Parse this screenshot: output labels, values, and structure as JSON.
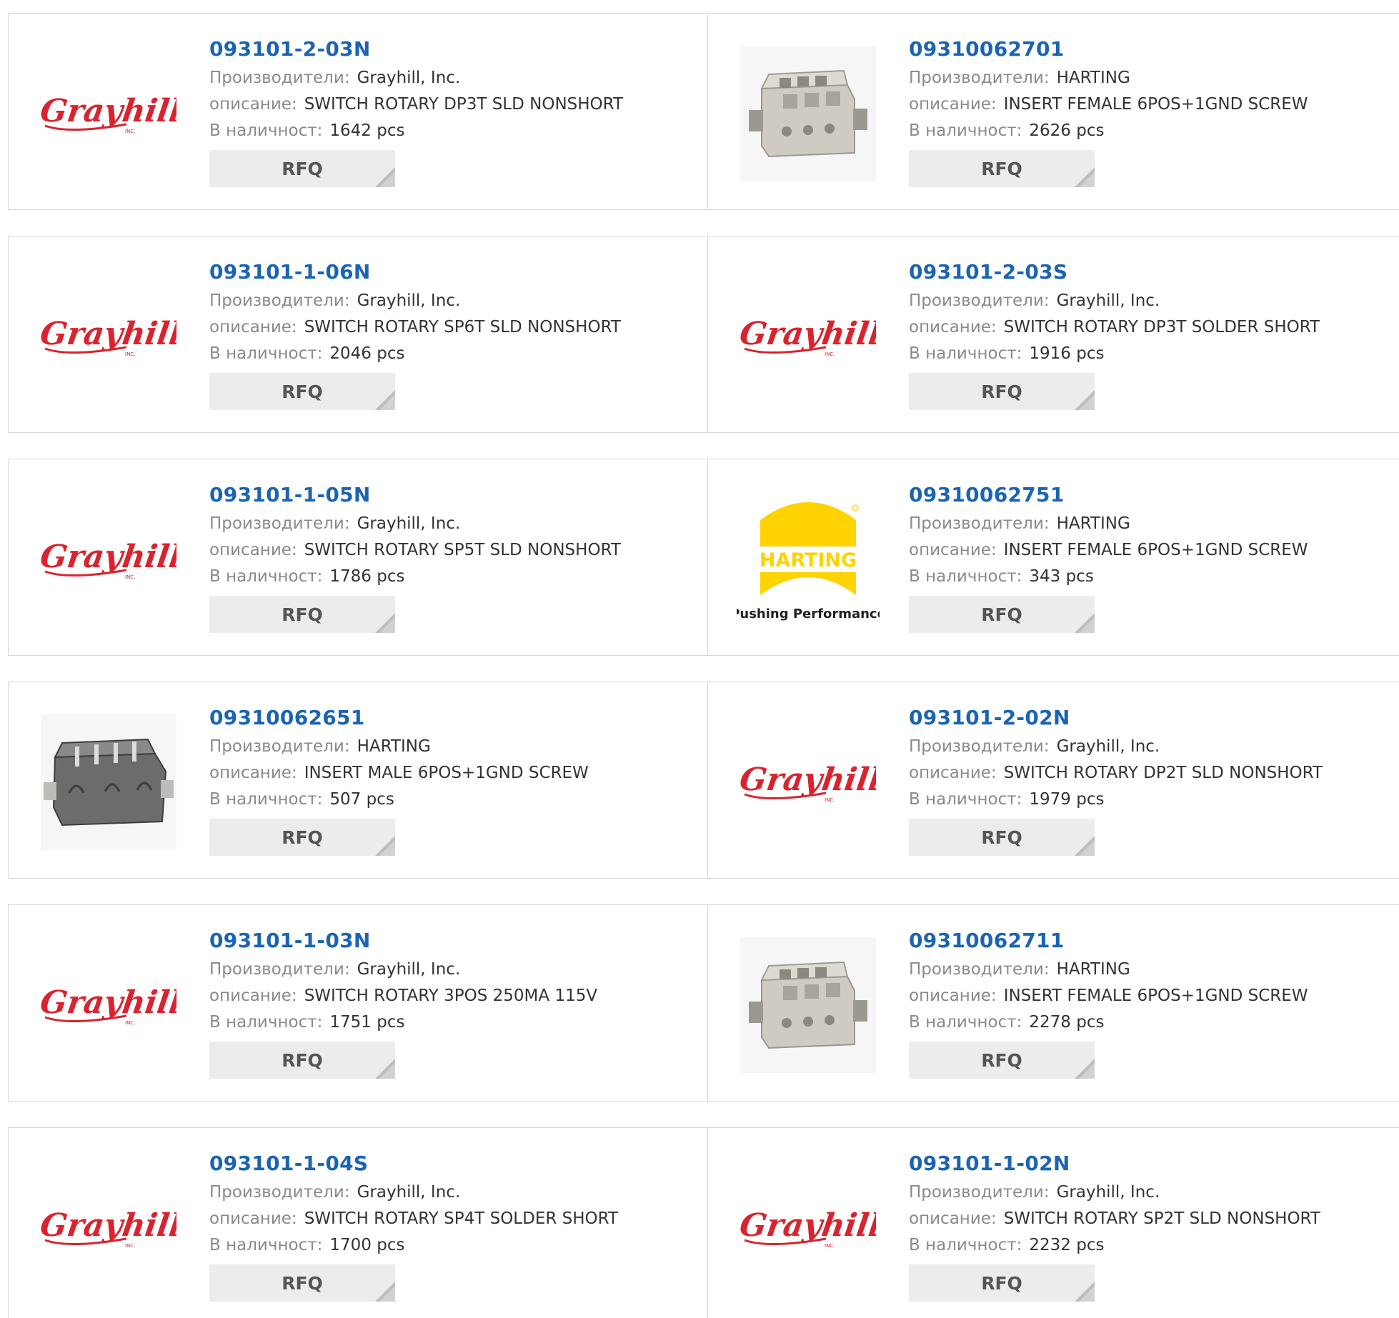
{
  "labels": {
    "manufacturer": "Производители:",
    "description": "описание:",
    "stock": "В наличност:",
    "rfq": "RFQ"
  },
  "colors": {
    "part_number": "#1a64b3",
    "grayhill_red": "#d9232e",
    "harting_yellow": "#ffd200",
    "rfq_bg": "#ececec"
  },
  "rows": [
    [
      {
        "part": "093101-2-03N",
        "manufacturer": "Grayhill, Inc.",
        "description": "SWITCH ROTARY DP3T SLD NONSHORT",
        "stock": "1642 pcs",
        "image": "grayhill-logo"
      },
      {
        "part": "09310062701",
        "manufacturer": "HARTING",
        "description": "INSERT FEMALE 6POS+1GND SCREW",
        "stock": "2626 pcs",
        "image": "connector-female-photo"
      }
    ],
    [
      {
        "part": "093101-1-06N",
        "manufacturer": "Grayhill, Inc.",
        "description": "SWITCH ROTARY SP6T SLD NONSHORT",
        "stock": "2046 pcs",
        "image": "grayhill-logo"
      },
      {
        "part": "093101-2-03S",
        "manufacturer": "Grayhill, Inc.",
        "description": "SWITCH ROTARY DP3T SOLDER SHORT",
        "stock": "1916 pcs",
        "image": "grayhill-logo"
      }
    ],
    [
      {
        "part": "093101-1-05N",
        "manufacturer": "Grayhill, Inc.",
        "description": "SWITCH ROTARY SP5T SLD NONSHORT",
        "stock": "1786 pcs",
        "image": "grayhill-logo"
      },
      {
        "part": "09310062751",
        "manufacturer": "HARTING",
        "description": "INSERT FEMALE 6POS+1GND SCREW",
        "stock": "343 pcs",
        "image": "harting-logo"
      }
    ],
    [
      {
        "part": "09310062651",
        "manufacturer": "HARTING",
        "description": "INSERT MALE 6POS+1GND SCREW",
        "stock": "507 pcs",
        "image": "connector-male-photo"
      },
      {
        "part": "093101-2-02N",
        "manufacturer": "Grayhill, Inc.",
        "description": "SWITCH ROTARY DP2T SLD NONSHORT",
        "stock": "1979 pcs",
        "image": "grayhill-logo"
      }
    ],
    [
      {
        "part": "093101-1-03N",
        "manufacturer": "Grayhill, Inc.",
        "description": "SWITCH ROTARY 3POS 250MA 115V",
        "stock": "1751 pcs",
        "image": "grayhill-logo"
      },
      {
        "part": "09310062711",
        "manufacturer": "HARTING",
        "description": "INSERT FEMALE 6POS+1GND SCREW",
        "stock": "2278 pcs",
        "image": "connector-female-photo"
      }
    ],
    [
      {
        "part": "093101-1-04S",
        "manufacturer": "Grayhill, Inc.",
        "description": "SWITCH ROTARY SP4T SOLDER SHORT",
        "stock": "1700 pcs",
        "image": "grayhill-logo"
      },
      {
        "part": "093101-1-02N",
        "manufacturer": "Grayhill, Inc.",
        "description": "SWITCH ROTARY SP2T SLD NONSHORT",
        "stock": "2232 pcs",
        "image": "grayhill-logo"
      }
    ]
  ],
  "logos": {
    "grayhill_text": "Grayhill",
    "grayhill_inc": "INC.",
    "harting_text": "HARTING",
    "harting_tagline": "Pushing Performance"
  }
}
